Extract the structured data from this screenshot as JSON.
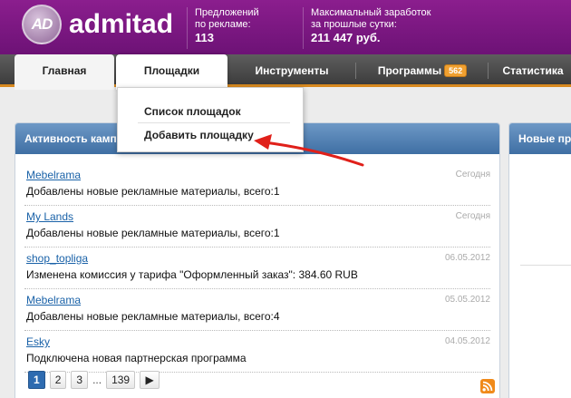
{
  "header": {
    "logo_badge": "AD",
    "logo_text": "admitad",
    "stat1_label_line1": "Предложений",
    "stat1_label_line2": "по рекламе:",
    "stat1_value": "113",
    "stat2_label_line1": "Максимальный заработок",
    "stat2_label_line2": "за прошлые сутки:",
    "stat2_value": "211 447 руб."
  },
  "nav": {
    "items": [
      {
        "label": "Главная"
      },
      {
        "label": "Площадки"
      },
      {
        "label": "Инструменты"
      },
      {
        "label": "Программы",
        "badge": "562"
      },
      {
        "label": "Статистика"
      }
    ]
  },
  "dropdown": {
    "items": [
      "Список площадок",
      "Добавить площадку"
    ]
  },
  "activity": {
    "title": "Активность кампа",
    "items": [
      {
        "link": "Mebelrama",
        "date": "Сегодня",
        "text": "Добавлены новые рекламные материалы, всего:1"
      },
      {
        "link": "My Lands",
        "date": "Сегодня",
        "text": "Добавлены новые рекламные материалы, всего:1"
      },
      {
        "link": "shop_topliga",
        "date": "06.05.2012",
        "text": "Изменена комиссия у тарифа \"Оформленный заказ\": 384.60 RUB"
      },
      {
        "link": "Mebelrama",
        "date": "05.05.2012",
        "text": "Добавлены новые рекламные материалы, всего:4"
      },
      {
        "link": "Esky",
        "date": "04.05.2012",
        "text": "Подключена новая партнерская программа"
      }
    ],
    "pager": {
      "pages": [
        "1",
        "2",
        "3"
      ],
      "dots": "...",
      "last": "139",
      "next": "▶"
    }
  },
  "right_panel": {
    "title": "Новые пр"
  },
  "colors": {
    "header_purple": "#7a1782",
    "nav_dark": "#4a4a4a",
    "nav_accent": "#d8891f",
    "panel_blue": "#3f6fa4",
    "link_blue": "#1a62a8",
    "arrow_red": "#e0201a"
  }
}
